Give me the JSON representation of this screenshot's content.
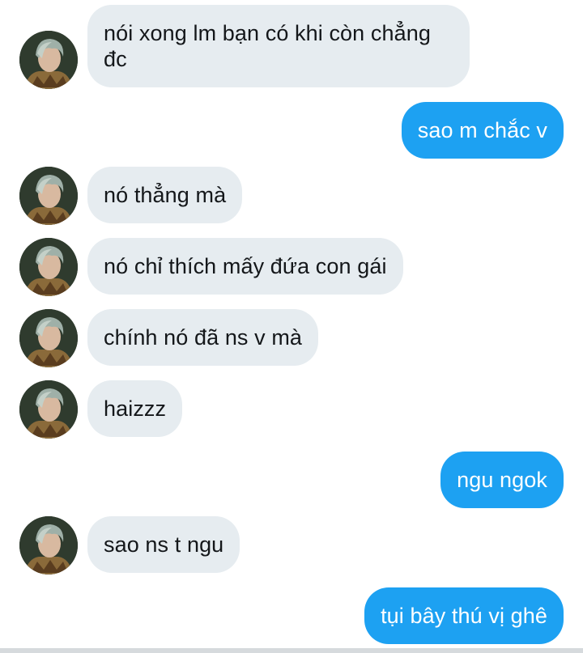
{
  "conversation": {
    "messages": [
      {
        "sender": "contact",
        "text": "nói xong lm bạn có khi còn chẳng\nđc"
      },
      {
        "sender": "me",
        "text": "sao m chắc v"
      },
      {
        "sender": "contact",
        "text": "nó thẳng mà"
      },
      {
        "sender": "contact",
        "text": "nó chỉ thích mấy đứa con gái"
      },
      {
        "sender": "contact",
        "text": "chính nó đã ns v mà"
      },
      {
        "sender": "contact",
        "text": "haizzz"
      },
      {
        "sender": "me",
        "text": "ngu ngok"
      },
      {
        "sender": "contact",
        "text": "sao ns t ngu"
      },
      {
        "sender": "me",
        "text": "tụi bây thú vị ghê"
      }
    ]
  },
  "colors": {
    "incoming_bubble": "#e6ecf0",
    "outgoing_bubble": "#1da1f2",
    "incoming_text": "#14171a",
    "outgoing_text": "#ffffff"
  },
  "icons": {
    "contact_avatar": "avatar-photo-icon"
  }
}
